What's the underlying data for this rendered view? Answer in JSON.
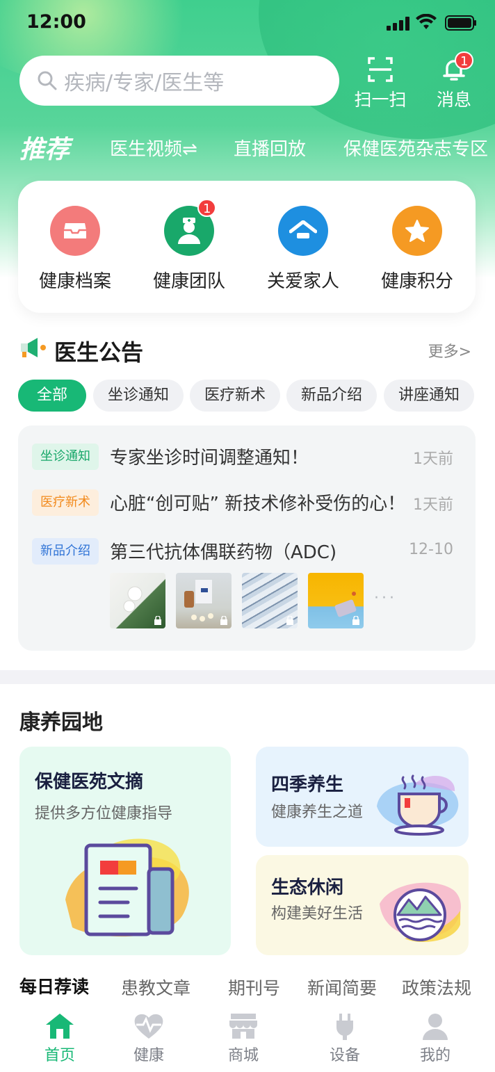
{
  "status_bar": {
    "time": "12:00"
  },
  "search": {
    "placeholder": "疾病/专家/医生等"
  },
  "header_buttons": {
    "scan_label": "扫一扫",
    "messages_label": "消息",
    "messages_badge": "1"
  },
  "content_tabs": [
    {
      "label": "推荐",
      "active": true
    },
    {
      "label": "医生视频⇌",
      "active": false
    },
    {
      "label": "直播回放",
      "active": false
    },
    {
      "label": "保健医苑杂志专区",
      "active": false
    }
  ],
  "quick_actions": [
    {
      "label": "健康档案",
      "icon": "archive-box-icon",
      "color": "#f37b7b"
    },
    {
      "label": "健康团队",
      "icon": "doctor-icon",
      "color": "#19a86a",
      "badge": "1"
    },
    {
      "label": "关爱家人",
      "icon": "home-icon",
      "color": "#1e8fe0"
    },
    {
      "label": "健康积分",
      "icon": "star-icon",
      "color": "#f59a23"
    }
  ],
  "notice": {
    "title": "医生公告",
    "more": "更多>",
    "filters": [
      "全部",
      "坐诊通知",
      "医疗新术",
      "新品介绍",
      "讲座通知"
    ],
    "items": [
      {
        "tag": "坐诊通知",
        "text": "专家坐诊时间调整通知！",
        "time": "1天前"
      },
      {
        "tag": "医疗新术",
        "text": "心脏“创可贴” 新技术修补受伤的心！",
        "time": "1天前"
      },
      {
        "tag": "新品介绍",
        "text": "第三代抗体偶联药物（ADC)",
        "time": "12-10"
      }
    ],
    "more_dots": "···"
  },
  "wellness": {
    "title": "康养园地",
    "cards": [
      {
        "title": "保健医苑文摘",
        "subtitle": "提供多方位健康指导"
      },
      {
        "title": "四季养生",
        "subtitle": "健康养生之道"
      },
      {
        "title": "生态休闲",
        "subtitle": "构建美好生活"
      }
    ]
  },
  "reading_tabs": [
    "每日荐读",
    "患教文章",
    "期刊号",
    "新闻简要",
    "政策法规"
  ],
  "tab_bar": [
    {
      "label": "首页",
      "icon": "home-icon",
      "active": true
    },
    {
      "label": "健康",
      "icon": "heart-pulse-icon",
      "active": false
    },
    {
      "label": "商城",
      "icon": "store-icon",
      "active": false
    },
    {
      "label": "设备",
      "icon": "plug-icon",
      "active": false
    },
    {
      "label": "我的",
      "icon": "user-icon",
      "active": false
    }
  ],
  "colors": {
    "primary": "#18b876",
    "badge": "#f23d3d"
  }
}
